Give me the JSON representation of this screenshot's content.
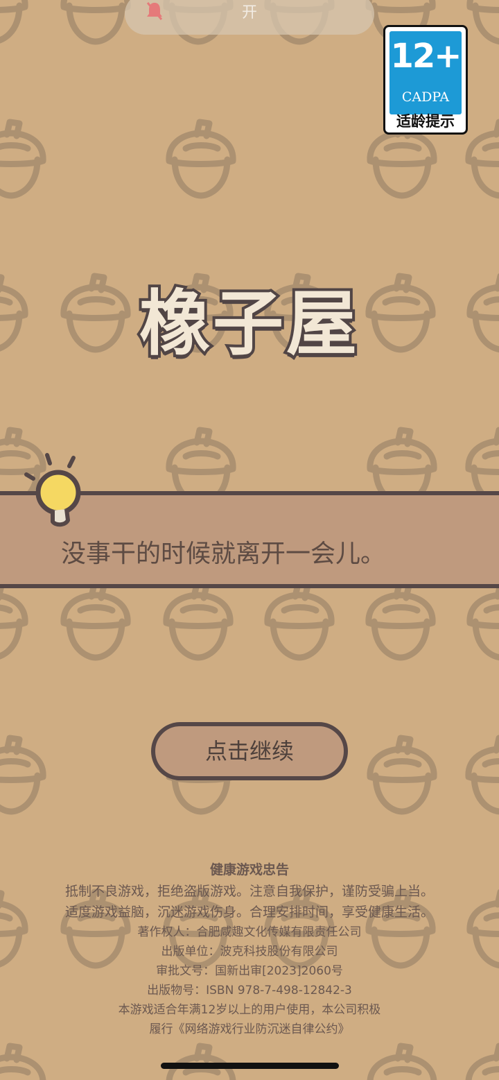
{
  "status_notification": {
    "icon": "bell-off-icon",
    "text": "开"
  },
  "age_rating": {
    "age": "12+",
    "org": "CADPA",
    "hint": "适龄提示",
    "color": "#1d9ad6"
  },
  "logo": {
    "title": "橡子屋"
  },
  "tip": {
    "icon": "lightbulb-icon",
    "text": "没事干的时候就离开一会儿。"
  },
  "continue_button": {
    "label": "点击继续"
  },
  "health_notice": {
    "title": "健康游戏忠告",
    "line1": "抵制不良游戏，拒绝盗版游戏。注意自我保护，谨防受骗上当。",
    "line2": "适度游戏益脑，沉迷游戏伤身。合理安排时间，享受健康生活。",
    "copyright": "著作权人：合肥咸趣文化传媒有限责任公司",
    "publisher": "出版单位：波克科技股份有限公司",
    "approval": "审批文号：国新出审[2023]2060号",
    "isbn": "出版物号：ISBN 978-7-498-12842-3",
    "age_line": "本游戏适合年满12岁以上的用户使用，本公司积极",
    "pledge": "履行《网络游戏行业防沉迷自律公约》"
  },
  "colors": {
    "background": "#cfad83",
    "band": "#bf9a7e",
    "outline": "#554747",
    "acorn_pattern": "#ac9171"
  }
}
